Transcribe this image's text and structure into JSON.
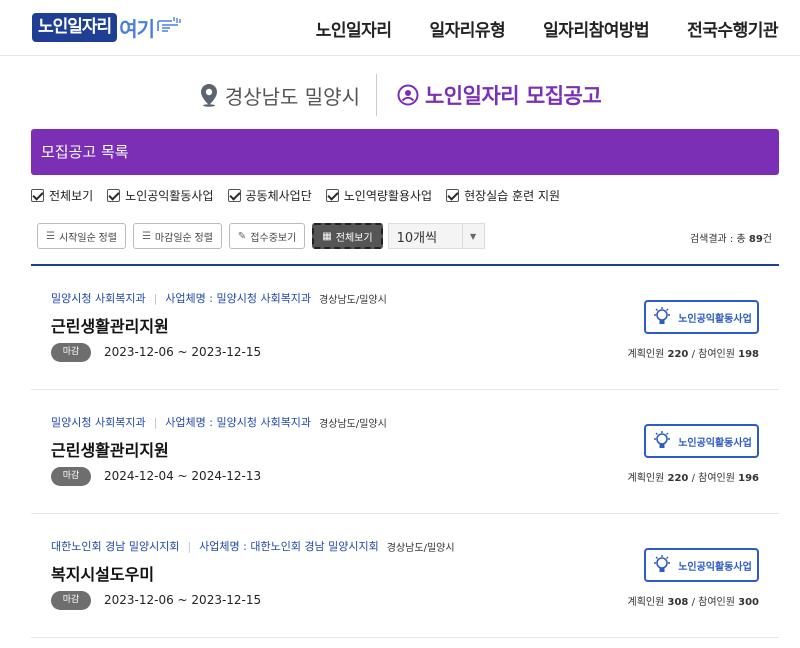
{
  "header": {
    "logo_main": "노인일자리",
    "logo_tail": "여기",
    "nav": [
      "노인일자리",
      "일자리유형",
      "일자리참여방법",
      "전국수행기관"
    ]
  },
  "title": {
    "region": "경상남도 밀양시",
    "notice": "노인일자리 모집공고",
    "region_icon": "location-pin-icon",
    "notice_icon": "person-circle-icon"
  },
  "list_bar": {
    "label": "모집공고 목록"
  },
  "filters": [
    "전체보기",
    "노인공익활동사업",
    "공동체사업단",
    "노인역량활용사업",
    "현장실습 훈련 지원"
  ],
  "toolbar": {
    "sort_start": "시작일순 정렬",
    "sort_end": "마감일순 정렬",
    "open_only": "접수중보기",
    "view_all": "전체보기",
    "page_size": "10개씩"
  },
  "result": {
    "prefix": "검색결과 : 총",
    "count": "89",
    "suffix": "건"
  },
  "colors": {
    "purple": "#7a2fb4",
    "navy": "#1f3f95",
    "blue": "#2d5bc4"
  },
  "items": [
    {
      "org": "밀양시청 사회복지과",
      "biz_label": "사업체명 : 밀양시청 사회복지과",
      "loc": "경상남도/밀양시",
      "title": "근린생활관리지원",
      "status": "마감",
      "period": "2023-12-06 ~ 2023-12-15",
      "category": "노인공익활동사업",
      "plan_label": "계획인원",
      "plan": "220",
      "join_label": "/ 참여인원",
      "join": "198"
    },
    {
      "org": "밀양시청 사회복지과",
      "biz_label": "사업체명 : 밀양시청 사회복지과",
      "loc": "경상남도/밀양시",
      "title": "근린생활관리지원",
      "status": "마감",
      "period": "2024-12-04 ~ 2024-12-13",
      "category": "노인공익활동사업",
      "plan_label": "계획인원",
      "plan": "220",
      "join_label": "/ 참여인원",
      "join": "196"
    },
    {
      "org": "대한노인회 경남 밀양시지회",
      "biz_label": "사업체명 : 대한노인회 경남 밀양시지회",
      "loc": "경상남도/밀양시",
      "title": "복지시설도우미",
      "status": "마감",
      "period": "2023-12-06 ~ 2023-12-15",
      "category": "노인공익활동사업",
      "plan_label": "계획인원",
      "plan": "308",
      "join_label": "/ 참여인원",
      "join": "300"
    }
  ]
}
